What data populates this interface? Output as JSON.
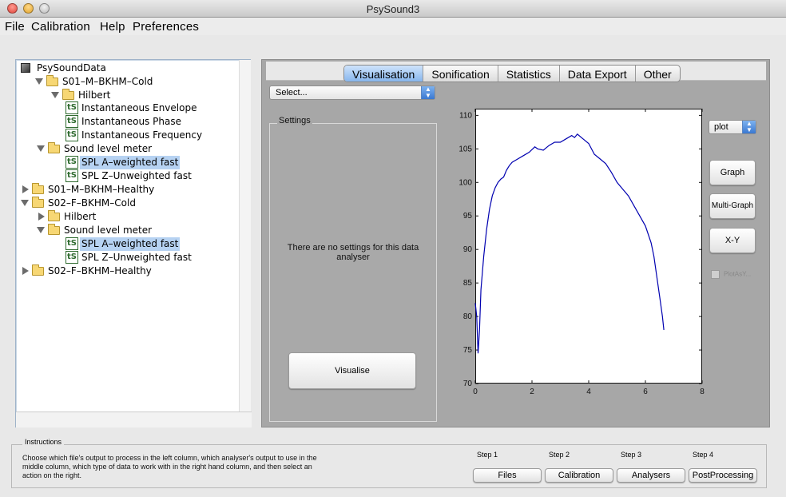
{
  "window": {
    "title": "PsySound3"
  },
  "menu": [
    "File",
    "Calibration",
    "Help",
    "Preferences"
  ],
  "tree": {
    "root": "PsySoundData",
    "nodes": [
      {
        "label": "S01–M–BKHM–Cold",
        "level": 1,
        "type": "folder",
        "expanded": true,
        "selected": false
      },
      {
        "label": "Hilbert",
        "level": 2,
        "type": "folder",
        "expanded": true,
        "selected": false
      },
      {
        "label": "Instantaneous Envelope",
        "level": 3,
        "type": "ts",
        "selected": false
      },
      {
        "label": "Instantaneous Phase",
        "level": 3,
        "type": "ts",
        "selected": false
      },
      {
        "label": "Instantaneous Frequency",
        "level": 3,
        "type": "ts",
        "selected": false
      },
      {
        "label": "Sound level meter",
        "level": 2,
        "type": "folder",
        "expanded": true,
        "selected": false
      },
      {
        "label": "SPL A–weighted fast",
        "level": 3,
        "type": "ts",
        "selected": true
      },
      {
        "label": "SPL Z–Unweighted fast",
        "level": 3,
        "type": "ts",
        "selected": false
      },
      {
        "label": "S01–M–BKHM–Healthy",
        "level": 1,
        "type": "folder",
        "expanded": false,
        "selected": false
      },
      {
        "label": "S02–F–BKHM–Cold",
        "level": 1,
        "type": "folder",
        "expanded": true,
        "selected": false
      },
      {
        "label": "Hilbert",
        "level": 2,
        "type": "folder",
        "expanded": false,
        "selected": false
      },
      {
        "label": "Sound level meter",
        "level": 2,
        "type": "folder",
        "expanded": true,
        "selected": false
      },
      {
        "label": "SPL A–weighted fast",
        "level": 3,
        "type": "ts",
        "selected": true
      },
      {
        "label": "SPL Z–Unweighted fast",
        "level": 3,
        "type": "ts",
        "selected": false
      },
      {
        "label": "S02–F–BKHM–Healthy",
        "level": 1,
        "type": "folder",
        "expanded": false,
        "selected": false
      }
    ],
    "ts_icon_text": "tS"
  },
  "tabs": [
    {
      "label": "Visualisation",
      "active": true
    },
    {
      "label": "Sonification",
      "active": false
    },
    {
      "label": "Statistics",
      "active": false
    },
    {
      "label": "Data Export",
      "active": false
    },
    {
      "label": "Other",
      "active": false
    }
  ],
  "analyser_select": {
    "value": "Select..."
  },
  "settings": {
    "title": "Settings",
    "message": "There are no settings for this data analyser",
    "visualise_button": "Visualise"
  },
  "plot_type_select": {
    "value": "plot"
  },
  "action_buttons": {
    "graph": "Graph",
    "multi_graph": "Multi-Graph",
    "xy": "X-Y"
  },
  "plot_as_checkbox": {
    "label": "PlotAsY...",
    "checked": false,
    "enabled": false
  },
  "chart_data": {
    "type": "line",
    "title": "",
    "xlabel": "",
    "ylabel": "",
    "xlim": [
      0,
      8
    ],
    "ylim": [
      70,
      111
    ],
    "xticks": [
      0,
      2,
      4,
      6,
      8
    ],
    "yticks": [
      70,
      75,
      80,
      85,
      90,
      95,
      100,
      105,
      110
    ],
    "color": "#0000b0",
    "series": [
      {
        "x": [
          0.0,
          0.05,
          0.1,
          0.15,
          0.2,
          0.3,
          0.4,
          0.5,
          0.6,
          0.7,
          0.8,
          0.9,
          1.0,
          1.1,
          1.2,
          1.3,
          1.5,
          1.7,
          1.9,
          2.1,
          2.2,
          2.4,
          2.6,
          2.8,
          3.0,
          3.2,
          3.4,
          3.5,
          3.6,
          3.8,
          4.0,
          4.2,
          4.4,
          4.6,
          4.8,
          5.0,
          5.2,
          5.4,
          5.6,
          5.8,
          6.0,
          6.2,
          6.3,
          6.4,
          6.5,
          6.6,
          6.65
        ],
        "y": [
          82,
          80,
          74.5,
          78,
          84,
          89,
          93,
          96,
          98,
          99.2,
          100,
          100.5,
          100.8,
          101.8,
          102.5,
          103,
          103.5,
          104,
          104.5,
          105.3,
          105,
          104.8,
          105.5,
          106,
          106,
          106.5,
          107,
          106.7,
          107.2,
          106.5,
          105.8,
          104.2,
          103.5,
          102.8,
          101.5,
          100,
          99,
          98,
          96.5,
          95,
          93.5,
          91,
          89,
          86,
          83,
          80,
          78
        ]
      }
    ]
  },
  "instructions": {
    "title": "Instructions",
    "text": "Choose which file's output to process in the left column, which analyser's output to use in the middle column, which type of data to work with in the right hand column, and then select an action on the right."
  },
  "steps": [
    {
      "label": "Step 1",
      "button": "Files"
    },
    {
      "label": "Step 2",
      "button": "Calibration"
    },
    {
      "label": "Step 3",
      "button": "Analysers"
    },
    {
      "label": "Step 4",
      "button": "PostProcessing"
    }
  ]
}
